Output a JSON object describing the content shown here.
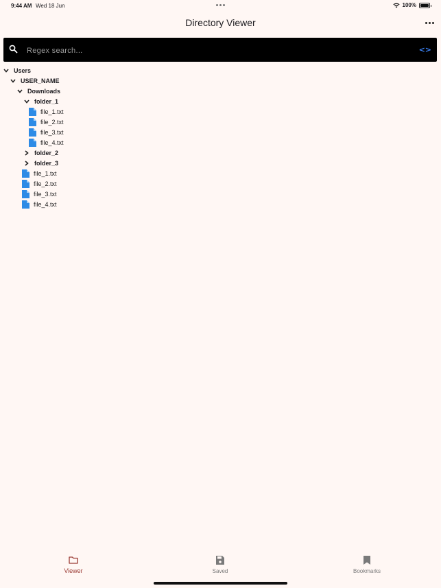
{
  "status": {
    "time": "9:44 AM",
    "date": "Wed 18 Jun",
    "battery": "100%"
  },
  "header": {
    "title": "Directory Viewer",
    "more_icon": "more-horizontal-icon"
  },
  "search": {
    "placeholder": "Regex search...",
    "value": "",
    "regex_toggle_icon": "code-brackets-icon",
    "regex_toggle_label": "<>"
  },
  "tree": {
    "users": "Users",
    "user_name": "USER_NAME",
    "downloads": "Downloads",
    "folder_1": "folder_1",
    "folder_1_files": [
      "file_1.txt",
      "file_2.txt",
      "file_3.txt",
      "file_4.txt"
    ],
    "folder_2": "folder_2",
    "folder_3": "folder_3",
    "downloads_files": [
      "file_1.txt",
      "file_2.txt",
      "file_3.txt",
      "file_4.txt"
    ]
  },
  "bottom_nav": {
    "viewer": "Viewer",
    "saved": "Saved",
    "bookmarks": "Bookmarks"
  },
  "colors": {
    "background": "#fff7f4",
    "accent": "#9b3b34",
    "file_icon": "#2d8be6",
    "regex_icon": "#3b82f6"
  }
}
